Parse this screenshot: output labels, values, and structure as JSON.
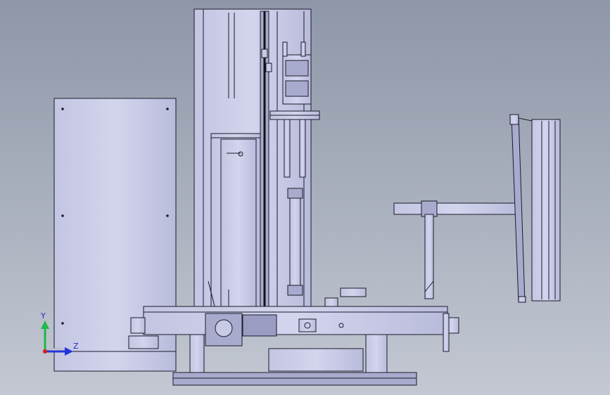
{
  "viewport": {
    "background_top": "#8e97a8",
    "background_bottom": "#c3c8d2"
  },
  "model": {
    "part_fill": "#c9cbe6",
    "part_fill_dark": "#a9abce",
    "edge_color": "#1a1a2a"
  },
  "triad": {
    "y_axis_label": "Y",
    "z_axis_label": "Z",
    "y_color": "#1fb84a",
    "z_color": "#2233dd",
    "origin_color": "#d81b1b"
  }
}
